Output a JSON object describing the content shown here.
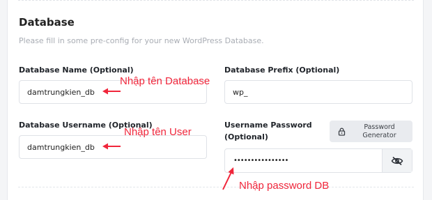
{
  "section": {
    "title": "Database",
    "description": "Please fill in some pre-config for your new WordPress Database."
  },
  "fields": {
    "db_name": {
      "label": "Database Name (Optional)",
      "value": "damtrungkien_db"
    },
    "db_prefix": {
      "label": "Database Prefix (Optional)",
      "value": "wp_"
    },
    "db_username": {
      "label": "Database Username (Optional)",
      "value": "damtrungkien_db"
    },
    "db_password": {
      "label_line1": "Username Password",
      "label_line2": "(Optional)",
      "value": "••••••••••••••••"
    }
  },
  "password_generator": {
    "line1": "Password",
    "line2": "Generator",
    "icon": "lock-icon"
  },
  "visibility_toggle": {
    "icon": "eye-off-icon"
  },
  "annotations": {
    "db_name": "Nhập tên Database",
    "db_username": "Nhập tên User",
    "db_password": "Nhập password DB",
    "color": "#f0263b"
  }
}
